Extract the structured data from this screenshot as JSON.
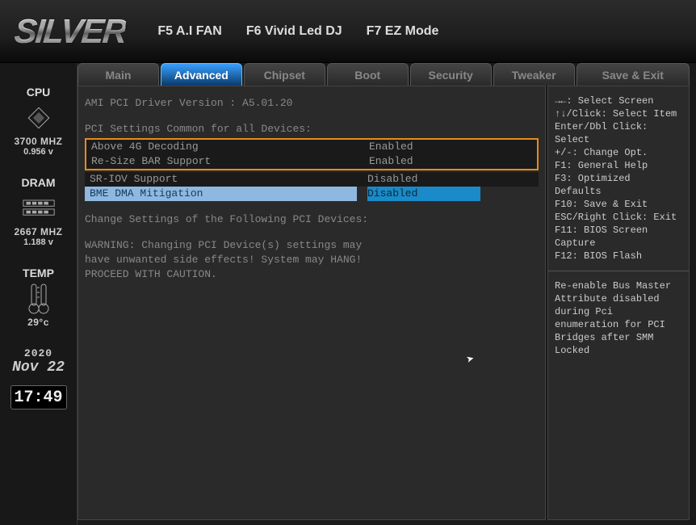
{
  "brand": "SILVER",
  "fkeys": [
    "F5 A.I FAN",
    "F6 Vivid Led DJ",
    "F7 EZ Mode"
  ],
  "tabs": [
    "Main",
    "Advanced",
    "Chipset",
    "Boot",
    "Security",
    "Tweaker",
    "Save & Exit"
  ],
  "active_tab": "Advanced",
  "sidebar": {
    "cpu": {
      "label": "CPU",
      "freq": "3700 MHZ",
      "volt": "0.956 v"
    },
    "dram": {
      "label": "DRAM",
      "freq": "2667 MHZ",
      "volt": "1.188 v"
    },
    "temp": {
      "label": "TEMP",
      "value": "29°c"
    },
    "date": {
      "year": "2020",
      "monthday": "Nov 22"
    },
    "clock": "17:49"
  },
  "main": {
    "driver_line": "AMI PCI Driver Version :  A5.01.20",
    "section_header": "PCI Settings Common for all Devices:",
    "rows": [
      {
        "label": "Above 4G Decoding",
        "value": "Enabled"
      },
      {
        "label": "Re-Size BAR Support",
        "value": "Enabled"
      },
      {
        "label": "SR-IOV Support",
        "value": "Disabled"
      },
      {
        "label": "BME DMA Mitigation",
        "value": "Disabled"
      }
    ],
    "change_line": "Change Settings of the Following PCI Devices:",
    "warning1": "WARNING: Changing PCI Device(s) settings may",
    "warning2": "have unwanted side effects! System may HANG!",
    "warning3": "PROCEED WITH CAUTION."
  },
  "help": {
    "lines": [
      "→←: Select Screen",
      "↑↓/Click: Select Item",
      "Enter/Dbl Click: Select",
      "+/-: Change Opt.",
      "F1: General Help",
      "F3: Optimized Defaults",
      "F10: Save & Exit",
      "ESC/Right Click: Exit",
      "F11: BIOS Screen Capture",
      "F12: BIOS Flash"
    ],
    "desc": "Re-enable Bus Master Attribute disabled during Pci enumeration for PCI Bridges after SMM Locked"
  }
}
